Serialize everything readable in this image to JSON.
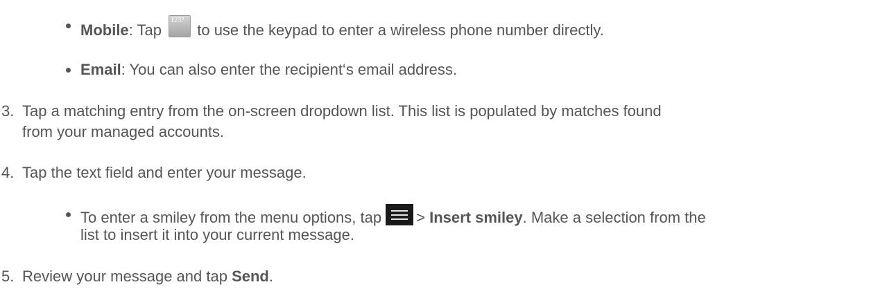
{
  "items": {
    "mobile": {
      "term": "Mobile",
      "pre": ": Tap",
      "icon_text": "123?",
      "post": "to use the keypad to enter a wireless phone number directly."
    },
    "email": {
      "term": "Email",
      "post": ": You can also enter the recipient‘s email address."
    },
    "step3": {
      "number": "3.",
      "line1": "Tap a matching entry from the on-screen dropdown list. This list is populated by matches found",
      "line2": "from your managed accounts."
    },
    "step4": {
      "number": "4.",
      "text": "Tap the text field and enter your message."
    },
    "smiley": {
      "pre": "To enter a smiley from the menu options, tap",
      "sep": ">",
      "option": "Insert smiley",
      "post": ". Make a selection from the",
      "line2": "list to insert it into your current message."
    },
    "step5": {
      "number": "5.",
      "pre": "Review your message and tap",
      "button": "Send",
      "post": "."
    }
  }
}
